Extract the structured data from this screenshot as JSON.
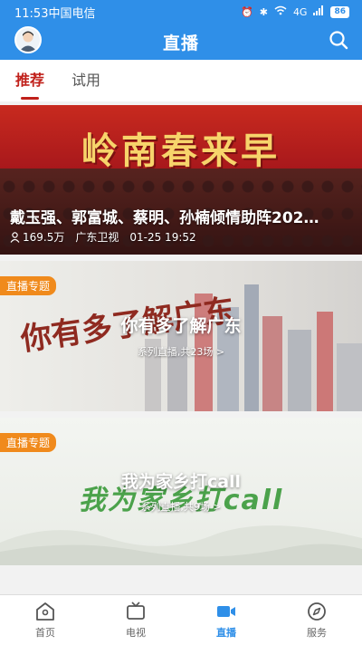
{
  "status": {
    "time": "11:53",
    "carrier": "中国电信",
    "network": "4G",
    "battery": "86"
  },
  "header": {
    "title": "直播",
    "search_icon": "search-icon",
    "avatar_icon": "avatar-icon"
  },
  "tabs": [
    {
      "label": "推荐",
      "active": true
    },
    {
      "label": "试用",
      "active": false
    }
  ],
  "feature": {
    "banner_text": "岭南春来早",
    "title": "戴玉强、郭富城、蔡明、孙楠倾情助阵202…",
    "views": "169.5万",
    "channel": "广东卫视",
    "time": "01-25 19:52"
  },
  "topics": [
    {
      "badge": "直播专题",
      "title": "你有多了解广东",
      "subtitle": "系列直播,共23场 >",
      "art_text": "你有多了解广东"
    },
    {
      "badge": "直播专题",
      "title": "我为家乡打call",
      "subtitle": "系列直播,共9场 >",
      "art_text": "我为家乡打call"
    }
  ],
  "bottom_nav": [
    {
      "label": "首页",
      "icon": "home-icon",
      "active": false
    },
    {
      "label": "电视",
      "icon": "tv-icon",
      "active": false
    },
    {
      "label": "直播",
      "icon": "video-icon",
      "active": true
    },
    {
      "label": "服务",
      "icon": "compass-icon",
      "active": false
    }
  ],
  "colors": {
    "accent": "#2f8fe8",
    "tab_active": "#c0201a",
    "badge": "#f08a1c"
  }
}
